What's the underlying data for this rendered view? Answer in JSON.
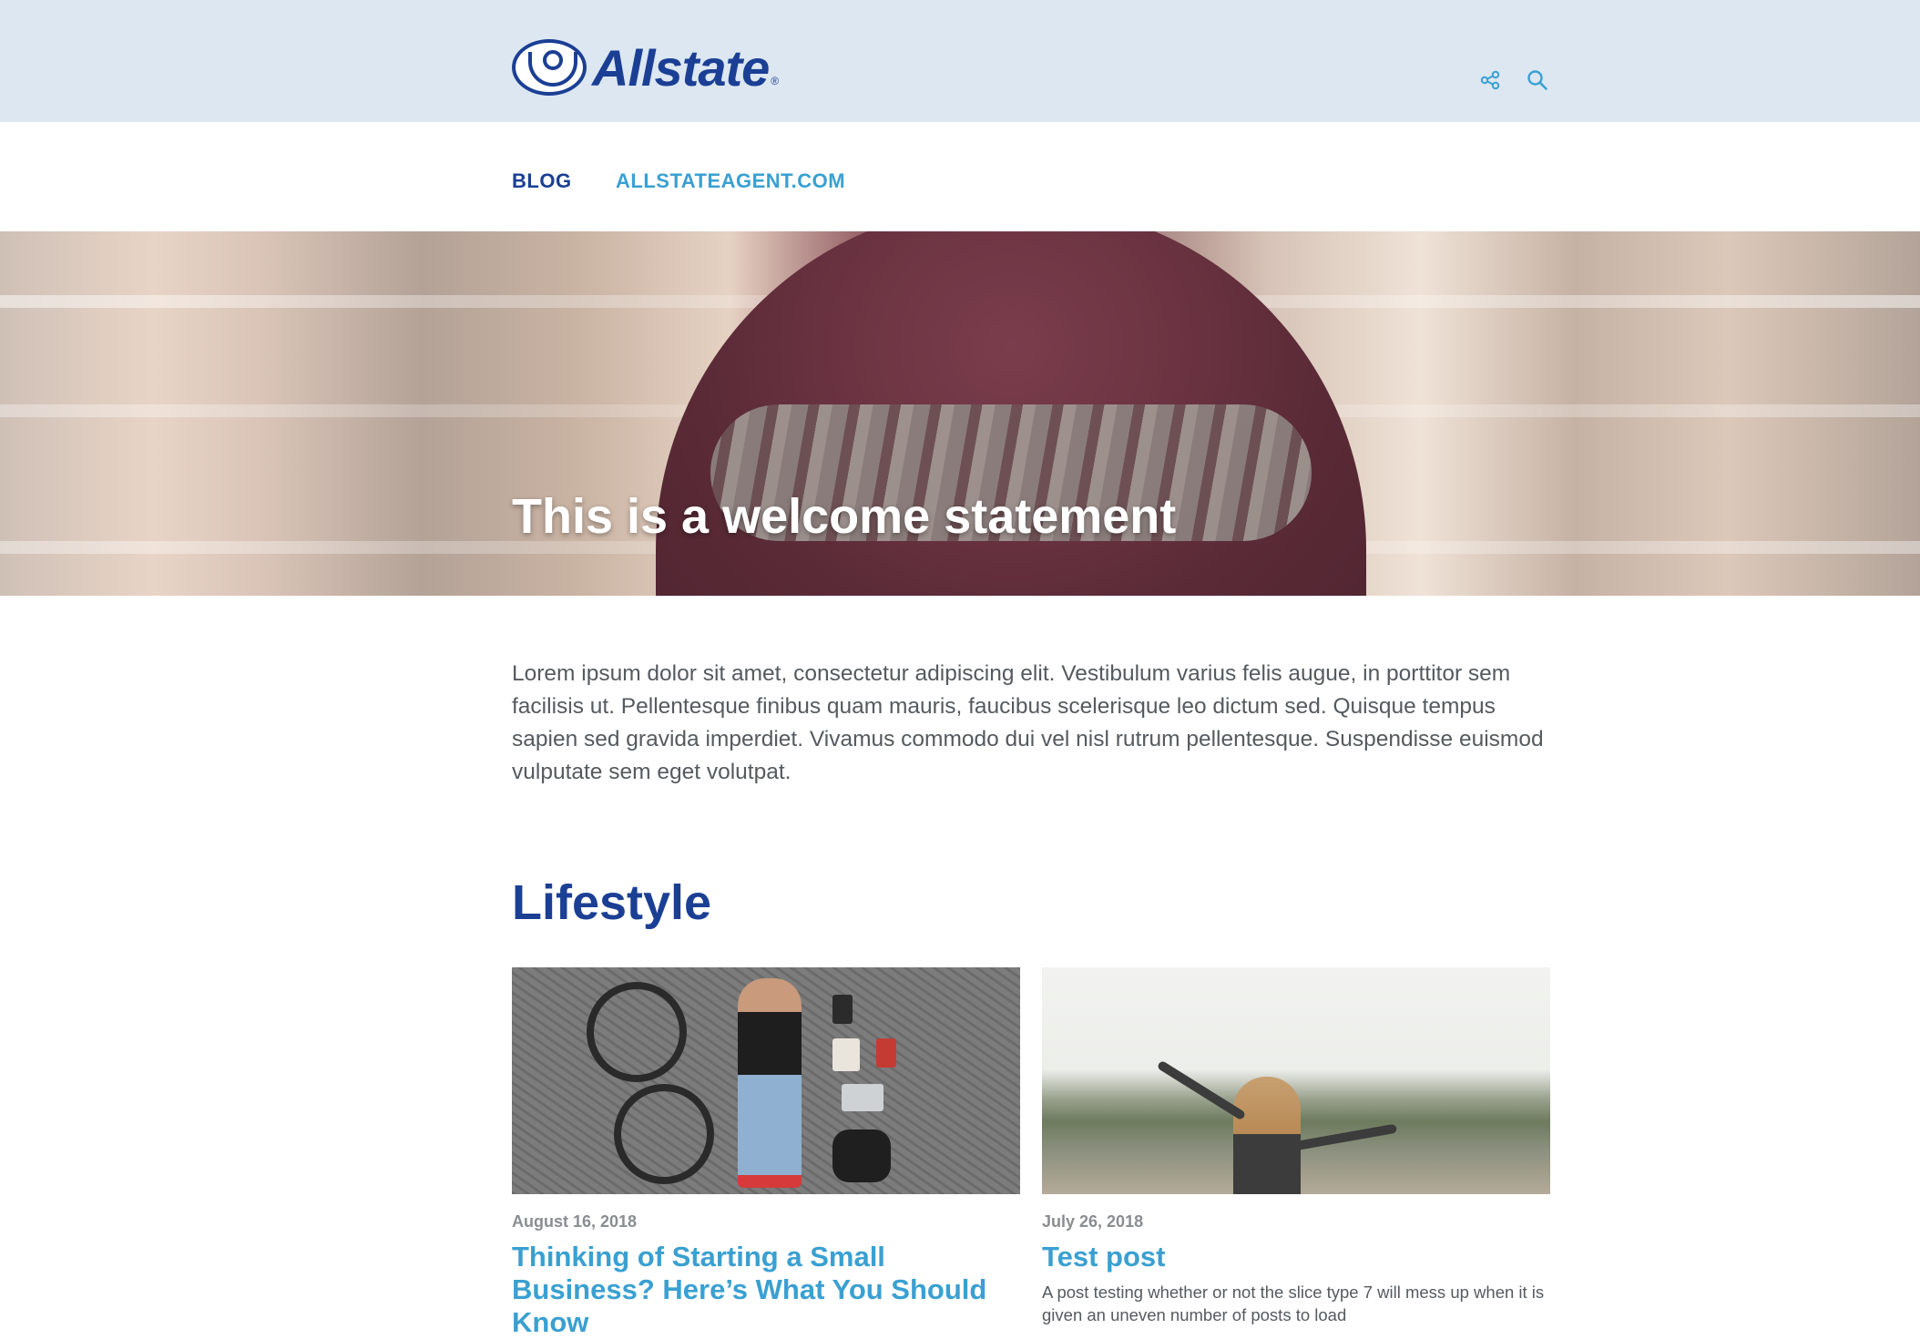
{
  "header": {
    "brand": "Allstate",
    "brand_mark": "®",
    "icons": [
      "share-icon",
      "search-icon"
    ]
  },
  "nav": {
    "items": [
      {
        "label": "BLOG"
      },
      {
        "label": "ALLSTATEAGENT.COM"
      }
    ]
  },
  "hero": {
    "title": "This is a welcome statement"
  },
  "intro": {
    "text": "Lorem ipsum dolor sit amet, consectetur adipiscing elit. Vestibulum varius felis augue, in porttitor sem facilisis ut. Pellentesque finibus quam mauris, faucibus scelerisque leo dictum sed. Quisque tempus sapien sed gravida imperdiet. Vivamus commodo dui vel nisl rutrum pellentesque. Suspendisse euismod vulputate sem eget volutpat."
  },
  "section": {
    "title": "Lifestyle"
  },
  "posts": [
    {
      "date": "August 16, 2018",
      "title": "Thinking of Starting a Small Business? Here’s What You Should Know",
      "description": ""
    },
    {
      "date": "July 26, 2018",
      "title": "Test post",
      "description": "A post testing whether or not the slice type 7 will mess up when it is given an uneven number of posts to load"
    }
  ],
  "colors": {
    "brand_blue": "#1b3f94",
    "link_blue": "#3aa0d1",
    "header_bg": "#dce7f2",
    "body_text": "#555a5f"
  }
}
